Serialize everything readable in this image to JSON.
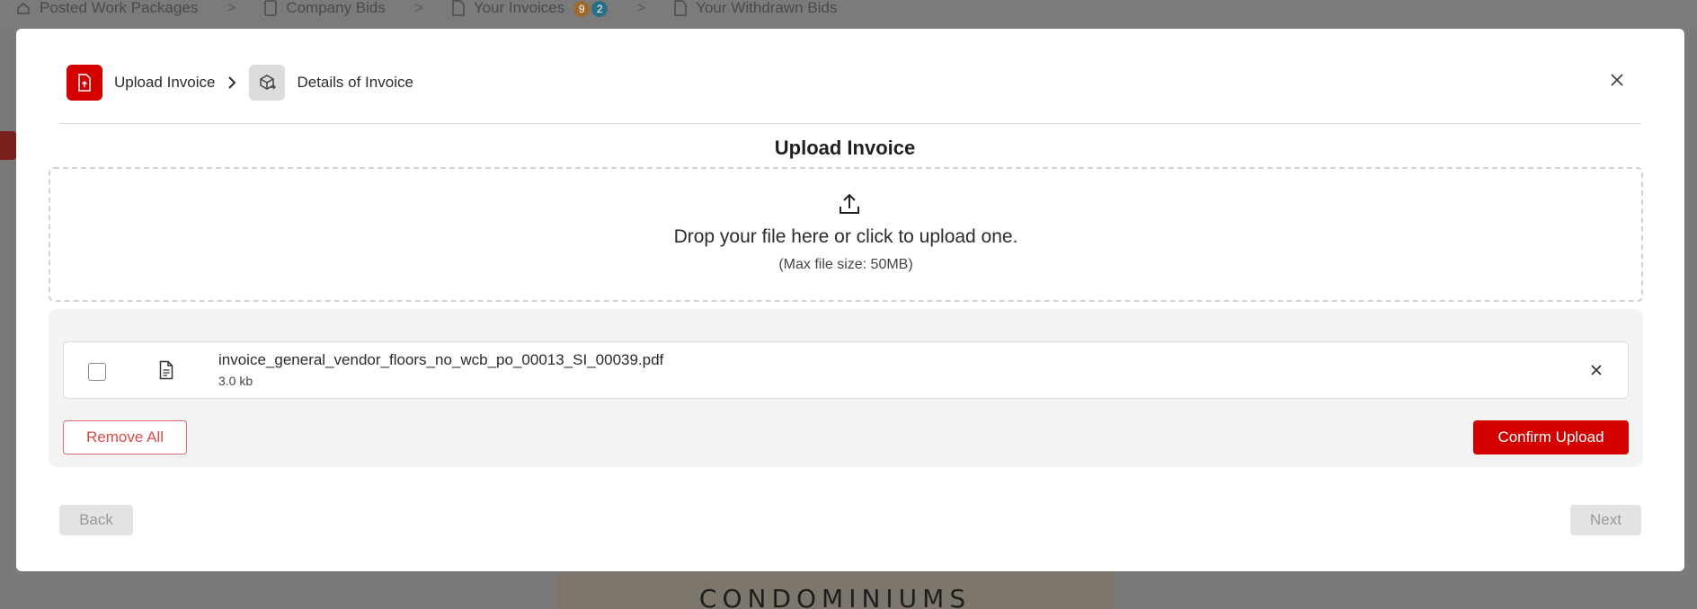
{
  "background": {
    "nav": [
      {
        "label": "Posted Work Packages"
      },
      {
        "label": "Company Bids"
      },
      {
        "label": "Your Invoices",
        "badges": [
          "9",
          "2"
        ]
      },
      {
        "label": "Your Withdrawn Bids"
      }
    ],
    "separator": ">",
    "bottom_text": "CONDOMINIUMS"
  },
  "modal": {
    "stepper": {
      "step1": "Upload Invoice",
      "step2": "Details of Invoice"
    },
    "title": "Upload Invoice",
    "dropzone": {
      "text": "Drop your file here or click to upload one.",
      "subtext": "(Max file size: 50MB)"
    },
    "files": [
      {
        "name": "invoice_general_vendor_floors_no_wcb_po_00013_SI_00039.pdf",
        "size": "3.0 kb",
        "checked": false
      }
    ],
    "remove_all_label": "Remove All",
    "confirm_label": "Confirm Upload",
    "back_label": "Back",
    "next_label": "Next"
  },
  "colors": {
    "accent": "#d40000",
    "overlay": "#7a7a7a"
  }
}
